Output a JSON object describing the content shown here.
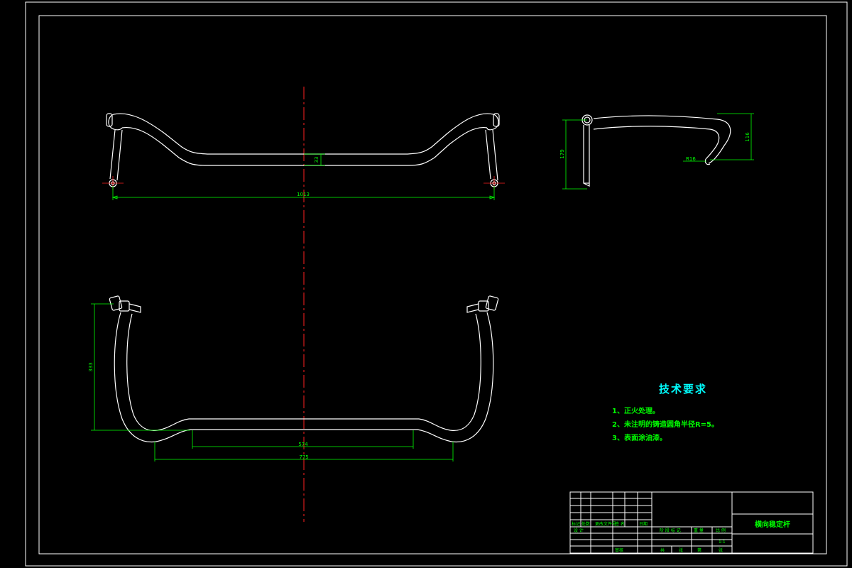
{
  "dimensions": {
    "front_width": "1013",
    "front_drop": "33",
    "side_height": "179",
    "side_drop": "116",
    "side_bend_radius": "R16",
    "top_depth": "333",
    "top_inner_width": "574",
    "top_outer_width": "775"
  },
  "technical_requirements": {
    "title": "技术要求",
    "items": [
      "1、正火处理。",
      "2、未注明的铸造圆角半径R=5。",
      "3、表面涂油漆。"
    ]
  },
  "title_block": {
    "part_name": "横向稳定杆",
    "scale_value": "1:1",
    "labels": {
      "mark": "标记",
      "count": "处数",
      "change_doc": "更改文件号",
      "signature": "签 名",
      "date": "日期",
      "design": "设 计",
      "stage_mark": "阶 段 标 记",
      "weight": "重 量",
      "scale": "比 例",
      "total": "共",
      "sheet": "张",
      "sheet_no": "第",
      "review": "审核",
      "approve": "批准"
    }
  },
  "colors": {
    "background": "#000000",
    "outline": "#ffffff",
    "dimension": "#00ff00",
    "centerline": "#ff2020",
    "note_title": "#00ffff"
  }
}
